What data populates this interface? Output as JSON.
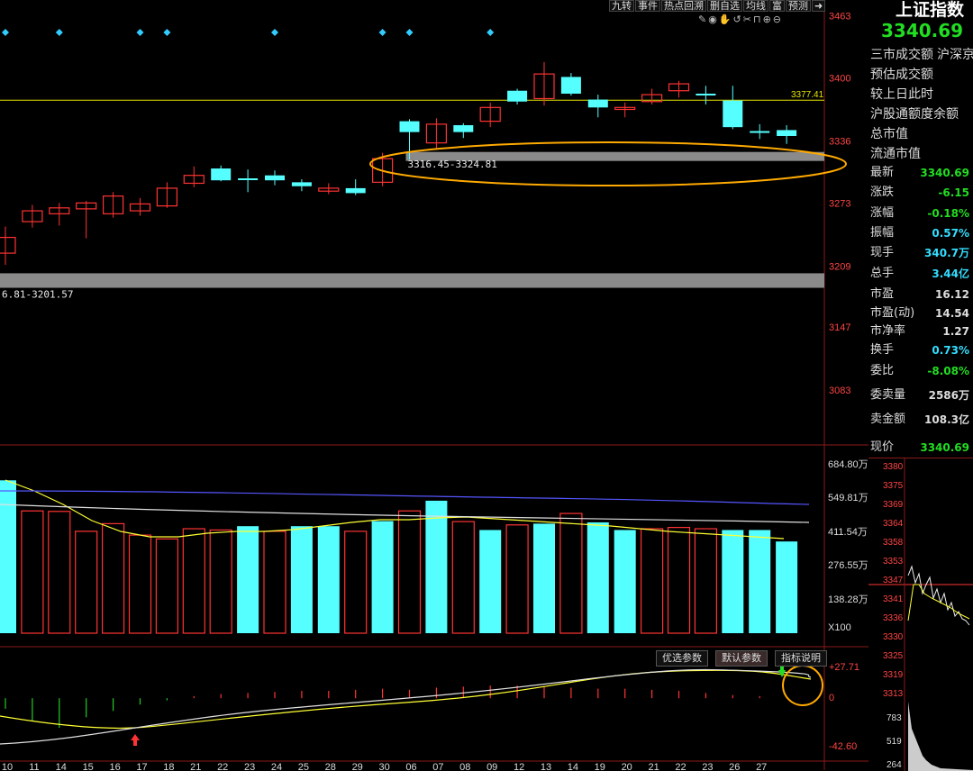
{
  "header": {
    "title": "上证指数",
    "price": "3340.69"
  },
  "toolbar": {
    "items": [
      "九转",
      "事件",
      "热点回溯",
      "删自选",
      "均线",
      "富",
      "预测"
    ]
  },
  "sidebar": {
    "menu": [
      "三市成交额",
      "沪深京",
      "预估成交额",
      "较上日此时",
      "沪股通额度余额",
      "总市值",
      "流通市值"
    ],
    "stats": [
      {
        "label": "最新",
        "value": "3340.69",
        "color": "#22dd22"
      },
      {
        "label": "涨跌",
        "value": "-6.15",
        "color": "#22dd22"
      },
      {
        "label": "涨幅",
        "value": "-0.18%",
        "color": "#22dd22"
      },
      {
        "label": "振幅",
        "value": "0.57%",
        "color": "#33ddff"
      },
      {
        "label": "现手",
        "value": "340.7万",
        "color": "#33ddff"
      },
      {
        "label": "总手",
        "value": "3.44亿",
        "color": "#33ddff"
      },
      {
        "label": "市盈",
        "value": "16.12",
        "color": "#dddddd"
      },
      {
        "label": "市盈(动)",
        "value": "14.54",
        "color": "#dddddd"
      },
      {
        "label": "市净率",
        "value": "1.27",
        "color": "#dddddd"
      },
      {
        "label": "换手",
        "value": "0.73%",
        "color": "#33ddff"
      },
      {
        "label": "委比",
        "value": "-8.08%",
        "color": "#22dd22"
      },
      {
        "label": "委卖量",
        "value": "2586万",
        "color": "#dddddd"
      },
      {
        "label": "卖金额",
        "value": "108.3亿",
        "color": "#dddddd"
      },
      {
        "label": "现价",
        "value": "3340.69",
        "color": "#22dd22"
      }
    ],
    "mini_axis": [
      "3380",
      "3375",
      "3369",
      "3364",
      "3358",
      "3353",
      "3347",
      "3341",
      "3336",
      "3330",
      "3325",
      "3319",
      "3313"
    ],
    "mini_vol_axis": [
      "783",
      "519",
      "264"
    ]
  },
  "chart_data": {
    "type": "candlestick",
    "price_axis_ticks": [
      "3463",
      "3400",
      "3336",
      "3273",
      "3209",
      "3147",
      "3083"
    ],
    "price_ylim": [
      3040,
      3470
    ],
    "hline_value": 3377.41,
    "hline_label": "3377.41",
    "gap_zones": [
      {
        "label": "3316.45-3324.81",
        "low": 3316.45,
        "high": 3324.81
      },
      {
        "label": "6.81-3201.57",
        "low": 3186.81,
        "high": 3201.57
      }
    ],
    "candles": [
      {
        "o": 3222,
        "c": 3238,
        "h": 3249,
        "l": 3210,
        "dir": "up"
      },
      {
        "o": 3254,
        "c": 3265,
        "h": 3271,
        "l": 3248,
        "dir": "up"
      },
      {
        "o": 3262,
        "c": 3268,
        "h": 3273,
        "l": 3250,
        "dir": "up"
      },
      {
        "o": 3267,
        "c": 3273,
        "h": 3275,
        "l": 3237,
        "dir": "up"
      },
      {
        "o": 3262,
        "c": 3280,
        "h": 3284,
        "l": 3258,
        "dir": "up"
      },
      {
        "o": 3265,
        "c": 3272,
        "h": 3278,
        "l": 3260,
        "dir": "up"
      },
      {
        "o": 3270,
        "c": 3288,
        "h": 3294,
        "l": 3268,
        "dir": "up"
      },
      {
        "o": 3293,
        "c": 3301,
        "h": 3310,
        "l": 3289,
        "dir": "up"
      },
      {
        "o": 3308,
        "c": 3296,
        "h": 3311,
        "l": 3295,
        "dir": "down"
      },
      {
        "o": 3298,
        "c": 3298,
        "h": 3307,
        "l": 3284,
        "dir": "flat"
      },
      {
        "o": 3301,
        "c": 3296,
        "h": 3306,
        "l": 3291,
        "dir": "down"
      },
      {
        "o": 3294,
        "c": 3290,
        "h": 3297,
        "l": 3285,
        "dir": "down"
      },
      {
        "o": 3285,
        "c": 3288,
        "h": 3293,
        "l": 3282,
        "dir": "up"
      },
      {
        "o": 3288,
        "c": 3283,
        "h": 3297,
        "l": 3281,
        "dir": "down"
      },
      {
        "o": 3294,
        "c": 3318,
        "h": 3324,
        "l": 3290,
        "dir": "up"
      },
      {
        "o": 3356,
        "c": 3345,
        "h": 3358,
        "l": 3317,
        "dir": "down"
      },
      {
        "o": 3334,
        "c": 3353,
        "h": 3359,
        "l": 3327,
        "dir": "up"
      },
      {
        "o": 3352,
        "c": 3345,
        "h": 3354,
        "l": 3339,
        "dir": "down"
      },
      {
        "o": 3356,
        "c": 3370,
        "h": 3375,
        "l": 3350,
        "dir": "up"
      },
      {
        "o": 3387,
        "c": 3376,
        "h": 3389,
        "l": 3373,
        "dir": "down"
      },
      {
        "o": 3379,
        "c": 3404,
        "h": 3416,
        "l": 3372,
        "dir": "up"
      },
      {
        "o": 3401,
        "c": 3384,
        "h": 3405,
        "l": 3382,
        "dir": "down"
      },
      {
        "o": 3378,
        "c": 3370,
        "h": 3383,
        "l": 3360,
        "dir": "down"
      },
      {
        "o": 3368,
        "c": 3370,
        "h": 3375,
        "l": 3360,
        "dir": "up"
      },
      {
        "o": 3376,
        "c": 3383,
        "h": 3389,
        "l": 3373,
        "dir": "up"
      },
      {
        "o": 3387,
        "c": 3394,
        "h": 3397,
        "l": 3380,
        "dir": "up"
      },
      {
        "o": 3384,
        "c": 3384,
        "h": 3392,
        "l": 3373,
        "dir": "flat"
      },
      {
        "o": 3377,
        "c": 3350,
        "h": 3392,
        "l": 3348,
        "dir": "down"
      },
      {
        "o": 3346,
        "c": 3346,
        "h": 3353,
        "l": 3338,
        "dir": "flat"
      },
      {
        "o": 3347,
        "c": 3341,
        "h": 3352,
        "l": 3333,
        "dir": "down"
      }
    ],
    "volume_axis_ticks": [
      "684.80万",
      "549.81万",
      "411.54万",
      "276.55万",
      "138.28万",
      "X100"
    ],
    "volume_ylim": [
      0,
      700
    ],
    "volume": [
      {
        "v": 600,
        "dir": "down"
      },
      {
        "v": 480,
        "dir": "up"
      },
      {
        "v": 478,
        "dir": "up"
      },
      {
        "v": 400,
        "dir": "up"
      },
      {
        "v": 430,
        "dir": "up"
      },
      {
        "v": 385,
        "dir": "up"
      },
      {
        "v": 370,
        "dir": "up"
      },
      {
        "v": 410,
        "dir": "up"
      },
      {
        "v": 405,
        "dir": "up"
      },
      {
        "v": 420,
        "dir": "down"
      },
      {
        "v": 400,
        "dir": "up"
      },
      {
        "v": 420,
        "dir": "down"
      },
      {
        "v": 420,
        "dir": "down"
      },
      {
        "v": 400,
        "dir": "up"
      },
      {
        "v": 440,
        "dir": "down"
      },
      {
        "v": 480,
        "dir": "up"
      },
      {
        "v": 520,
        "dir": "down"
      },
      {
        "v": 438,
        "dir": "up"
      },
      {
        "v": 405,
        "dir": "down"
      },
      {
        "v": 425,
        "dir": "up"
      },
      {
        "v": 430,
        "dir": "down"
      },
      {
        "v": 470,
        "dir": "up"
      },
      {
        "v": 435,
        "dir": "down"
      },
      {
        "v": 405,
        "dir": "down"
      },
      {
        "v": 410,
        "dir": "up"
      },
      {
        "v": 415,
        "dir": "up"
      },
      {
        "v": 410,
        "dir": "up"
      },
      {
        "v": 405,
        "dir": "down"
      },
      {
        "v": 405,
        "dir": "down"
      },
      {
        "v": 360,
        "dir": "down"
      }
    ],
    "macd_axis_ticks": [
      "+27.71",
      "0",
      "-42.60"
    ],
    "macd_ylim": [
      -45,
      30
    ],
    "macd_bars": [
      -10,
      -22,
      -28,
      -18,
      -12,
      -6,
      -2,
      2,
      4,
      5,
      6,
      7,
      7,
      8,
      9,
      8,
      10,
      11,
      12,
      12,
      11,
      10,
      9,
      9,
      8,
      7,
      5,
      3,
      2,
      1
    ],
    "x_labels": [
      "10",
      "11",
      "14",
      "15",
      "16",
      "17",
      "18",
      "21",
      "22",
      "23",
      "24",
      "25",
      "28",
      "29",
      "30",
      "06",
      "07",
      "08",
      "09",
      "12",
      "13",
      "14",
      "19",
      "20",
      "21",
      "22",
      "23",
      "26",
      "27"
    ],
    "macd_buttons": [
      "优选参数",
      "默认参数",
      "指标说明"
    ],
    "colors": {
      "up": "#ff3333",
      "down": "#55ffff",
      "ma_white": "#e0e0e0",
      "ma_yellow": "#ffff33",
      "ma_blue": "#5555ff",
      "highlight": "#ffaa00"
    }
  }
}
